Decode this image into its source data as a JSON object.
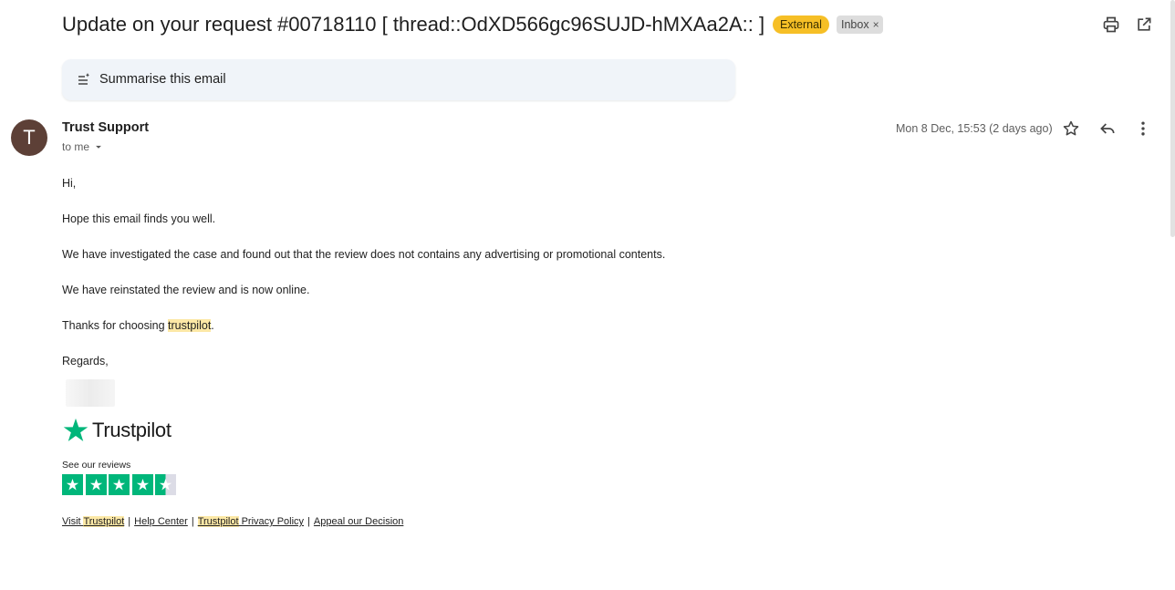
{
  "header": {
    "subject": "Update on your request #00718110 [ thread::OdXD566gc96SUJD-hMXAa2A:: ]",
    "badge_external": "External",
    "badge_inbox": "Inbox",
    "badge_inbox_close": "×"
  },
  "summary": {
    "label": "Summarise this email"
  },
  "message": {
    "avatar_letter": "T",
    "sender": "Trust Support",
    "recipient": "to me",
    "date": "Mon 8 Dec, 15:53 (2 days ago)",
    "greeting": "Hi,",
    "line1": "Hope this email finds you well.",
    "line2": "We have investigated the case and found out that the review does not contains any advertising or promotional contents.",
    "line3": "We have reinstated the review and is now online.",
    "line4_prefix": "Thanks for choosing ",
    "line4_highlight": "trustpilot",
    "line4_suffix": ".",
    "regards": "Regards,"
  },
  "signature": {
    "brand": "Trustpilot",
    "see_reviews": "See our reviews",
    "rating_stars": 4.5,
    "links": {
      "visit_prefix": "Visit ",
      "visit_highlight": "Trustpilot",
      "help": "Help Center",
      "privacy_highlight": "Trustpilot",
      "privacy_suffix": " Privacy Policy",
      "appeal": "Appeal our Decision",
      "separator": "|"
    }
  },
  "colors": {
    "external_badge": "#f6bf26",
    "trustpilot_green": "#00b67a",
    "avatar_bg": "#5d4037",
    "highlight": "#fce8a6"
  },
  "icons": [
    "print-icon",
    "open-in-new-window-icon",
    "summarise-icon",
    "chevron-down-icon",
    "star-icon",
    "reply-icon",
    "more-vertical-icon",
    "trustpilot-star-icon"
  ]
}
